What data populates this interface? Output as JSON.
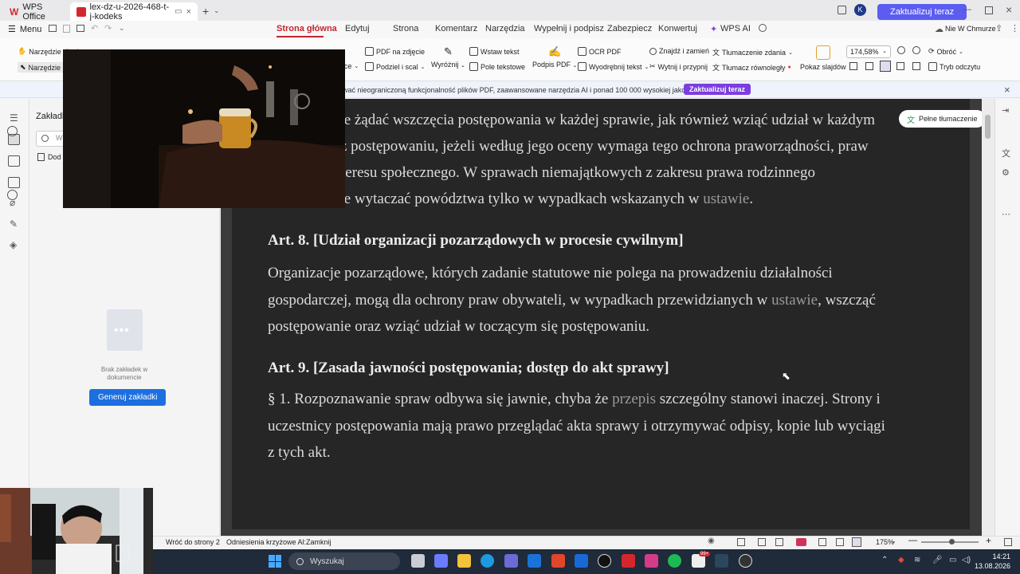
{
  "titlebar": {
    "app_tab": "WPS Office",
    "doc_tab": "lex-dz-u-2026-468-t-j-kodeks",
    "update_button": "Zaktualizuj teraz",
    "avatar_letter": "K"
  },
  "menu": {
    "menu_label": "Menu",
    "tabs": [
      "Strona główna",
      "Edytuj",
      "Strona",
      "Komentarz",
      "Narzędzia",
      "Wypełnij i podpisz",
      "Zabezpiecz",
      "Konwertuj",
      "WPS AI"
    ],
    "cloud_label": "Nie W Chmurze",
    "share_label": "Udostępnij"
  },
  "toolbar": {
    "hand_tool": "Narzędzie dłoni",
    "select_tool": "Narzędzie zaznaczania",
    "pdf_to_image": "PDF na zdjęcie",
    "split_merge": "Podziel i scal",
    "office_label": "ffice",
    "highlight": "Wyróżnij",
    "insert_text": "Wstaw tekst",
    "text_field": "Pole tekstowe",
    "pdf_sign": "Podpis PDF",
    "ocr": "OCR PDF",
    "extract_text": "Wyodrębnij tekst",
    "find_replace": "Znajdź i zamień",
    "cut_paste": "Wytnij i przypnij",
    "translate_sentence": "Tłumaczenie zdania",
    "translate_parallel": "Tłumacz równoległy",
    "slideshow": "Pokaz slajdów",
    "zoom": "174,58%",
    "rotate": "Obróć",
    "read_mode": "Tryb odczytu"
  },
  "notice": {
    "text": "ować nieograniczoną funkcjonalność plików PDF, zaawansowane narzędzia AI i ponad 100 000 wysokiej jakości szablonów.",
    "button": "Zaktualizuj teraz"
  },
  "bookmarks": {
    "title": "Zakładki",
    "search_placeholder": "W",
    "add_label": "Dod",
    "empty_line1": "Brak zakładek w",
    "empty_line2": "dokumencie",
    "generate_button": "Generuj zakładki"
  },
  "document": {
    "full_translation": "Pełne tłumaczenie",
    "para1": [
      {
        "text": "może żądać wszczęcia postępowania w każdej sprawie, jak również wziąć udział w każdym"
      },
      {
        "text": "e już postępowaniu, jeżeli według jego oceny wymaga tego ochrona praworządności, praw"
      },
      {
        "text": "b interesu społecznego. W sprawach niemajątkowych z zakresu prawa rodzinnego"
      },
      {
        "text_a": "może wytaczać powództwa tylko w wypadkach wskazanych w ",
        "link": "ustawie",
        "text_b": "."
      }
    ],
    "art8_heading": "Art. 8. [Udział organizacji pozarządowych w procesie cywilnym]",
    "art8_lines": [
      {
        "text": "Organizacje pozarządowe, których zadanie statutowe nie polega na prowadzeniu działalności"
      },
      {
        "text_a": "gospodarczej, mogą dla ochrony praw obywateli, w wypadkach przewidzianych w ",
        "link": "ustawie",
        "text_b": ", wszcząć"
      },
      {
        "text": "postępowanie oraz wziąć udział w toczącym się postępowaniu."
      }
    ],
    "art9_heading": "Art. 9. [Zasada jawności postępowania; dostęp do akt sprawy]",
    "art9_lines": [
      {
        "text_a": "§ 1. Rozpoznawanie spraw odbywa się jawnie, chyba że ",
        "link": "przepis",
        "text_b": " szczególny stanowi inaczej. Strony i"
      },
      {
        "text": "uczestnicy postępowania mają prawo przeglądać akta sprawy i otrzymywać odpisy, kopie lub wyciągi"
      },
      {
        "text": "z tych akt."
      }
    ]
  },
  "statusbar": {
    "back_to_page": "Wróć do strony 2",
    "cross_refs": "Odniesienia krzyżowe Al:Zamknij",
    "zoom": "175%"
  },
  "taskbar": {
    "search": "Wyszukaj",
    "time": "14:21",
    "date": "13.08.2026",
    "badge": "99+"
  }
}
